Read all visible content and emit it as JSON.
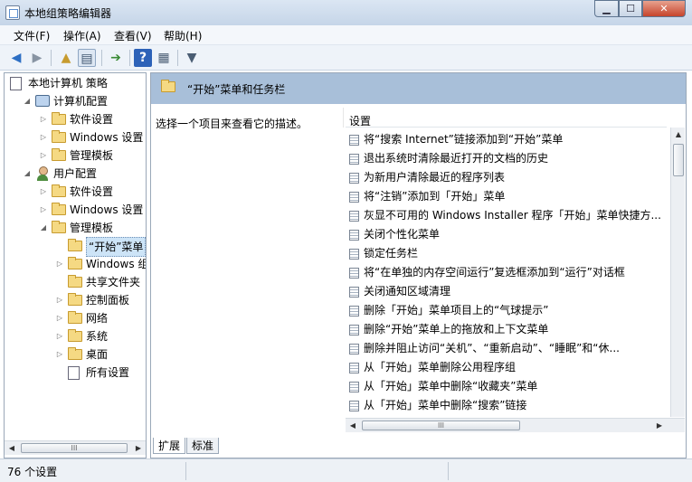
{
  "window": {
    "title": "本地组策略编辑器",
    "controls": [
      "minimize-icon",
      "maximize-icon",
      "close-icon"
    ]
  },
  "menu": [
    "文件(F)",
    "操作(A)",
    "查看(V)",
    "帮助(H)"
  ],
  "toolbar": [
    "back-arrow-icon",
    "forward-arrow-icon",
    "up-folder-icon",
    "show-hide-tree-icon",
    "export-list-icon",
    "help-icon",
    "properties-icon",
    "filter-icon"
  ],
  "tree": [
    {
      "label": "本地计算机 策略",
      "icon": "doc-icon",
      "depth": 0,
      "expanded": true
    },
    {
      "label": "计算机配置",
      "icon": "computer-icon",
      "depth": 1,
      "expanded": true
    },
    {
      "label": "软件设置",
      "icon": "folder-icon",
      "depth": 2,
      "expanded": false
    },
    {
      "label": "Windows 设置",
      "icon": "folder-icon",
      "depth": 2,
      "expanded": false
    },
    {
      "label": "管理模板",
      "icon": "folder-icon",
      "depth": 2,
      "expanded": false
    },
    {
      "label": "用户配置",
      "icon": "user-icon",
      "depth": 1,
      "expanded": true
    },
    {
      "label": "软件设置",
      "icon": "folder-icon",
      "depth": 2,
      "expanded": false
    },
    {
      "label": "Windows 设置",
      "icon": "folder-icon",
      "depth": 2,
      "expanded": false
    },
    {
      "label": "管理模板",
      "icon": "folder-icon",
      "depth": 2,
      "expanded": true
    },
    {
      "label": "“开始”菜单",
      "icon": "folder-icon",
      "depth": 3,
      "expanded": null,
      "selected": true
    },
    {
      "label": "Windows 组",
      "icon": "folder-icon",
      "depth": 3,
      "expanded": false
    },
    {
      "label": "共享文件夹",
      "icon": "folder-icon",
      "depth": 3,
      "expanded": null
    },
    {
      "label": "控制面板",
      "icon": "folder-icon",
      "depth": 3,
      "expanded": false
    },
    {
      "label": "网络",
      "icon": "folder-icon",
      "depth": 3,
      "expanded": false
    },
    {
      "label": "系统",
      "icon": "folder-icon",
      "depth": 3,
      "expanded": false
    },
    {
      "label": "桌面",
      "icon": "folder-icon",
      "depth": 3,
      "expanded": false
    },
    {
      "label": "所有设置",
      "icon": "doc-icon",
      "depth": 3,
      "expanded": null
    }
  ],
  "right": {
    "title": "“开始”菜单和任务栏",
    "description": "选择一个项目来查看它的描述。",
    "column_header": "设置",
    "settings": [
      "将“搜索 Internet”链接添加到“开始”菜单",
      "退出系统时清除最近打开的文档的历史",
      "为新用户清除最近的程序列表",
      "将“注销”添加到「开始」菜单",
      "灰显不可用的 Windows Installer 程序「开始」菜单快捷方...",
      "关闭个性化菜单",
      "锁定任务栏",
      "将“在单独的内存空间运行”复选框添加到“运行”对话框",
      "关闭通知区域清理",
      "删除「开始」菜单项目上的“气球提示”",
      "删除“开始”菜单上的拖放和上下文菜单",
      "删除并阻止访问“关机”、“重新启动”、“睡眠”和“休...",
      "从「开始」菜单删除公用程序组",
      "从「开始」菜单中删除“收藏夹”菜单",
      "从「开始」菜单中删除“搜索”链接"
    ]
  },
  "tabs": [
    "扩展",
    "标准"
  ],
  "status": "76 个设置",
  "scrollbar_thumb_glyph": "III",
  "colors": {
    "header_band": "#a8bfd9",
    "selection": "#cde4f7"
  }
}
